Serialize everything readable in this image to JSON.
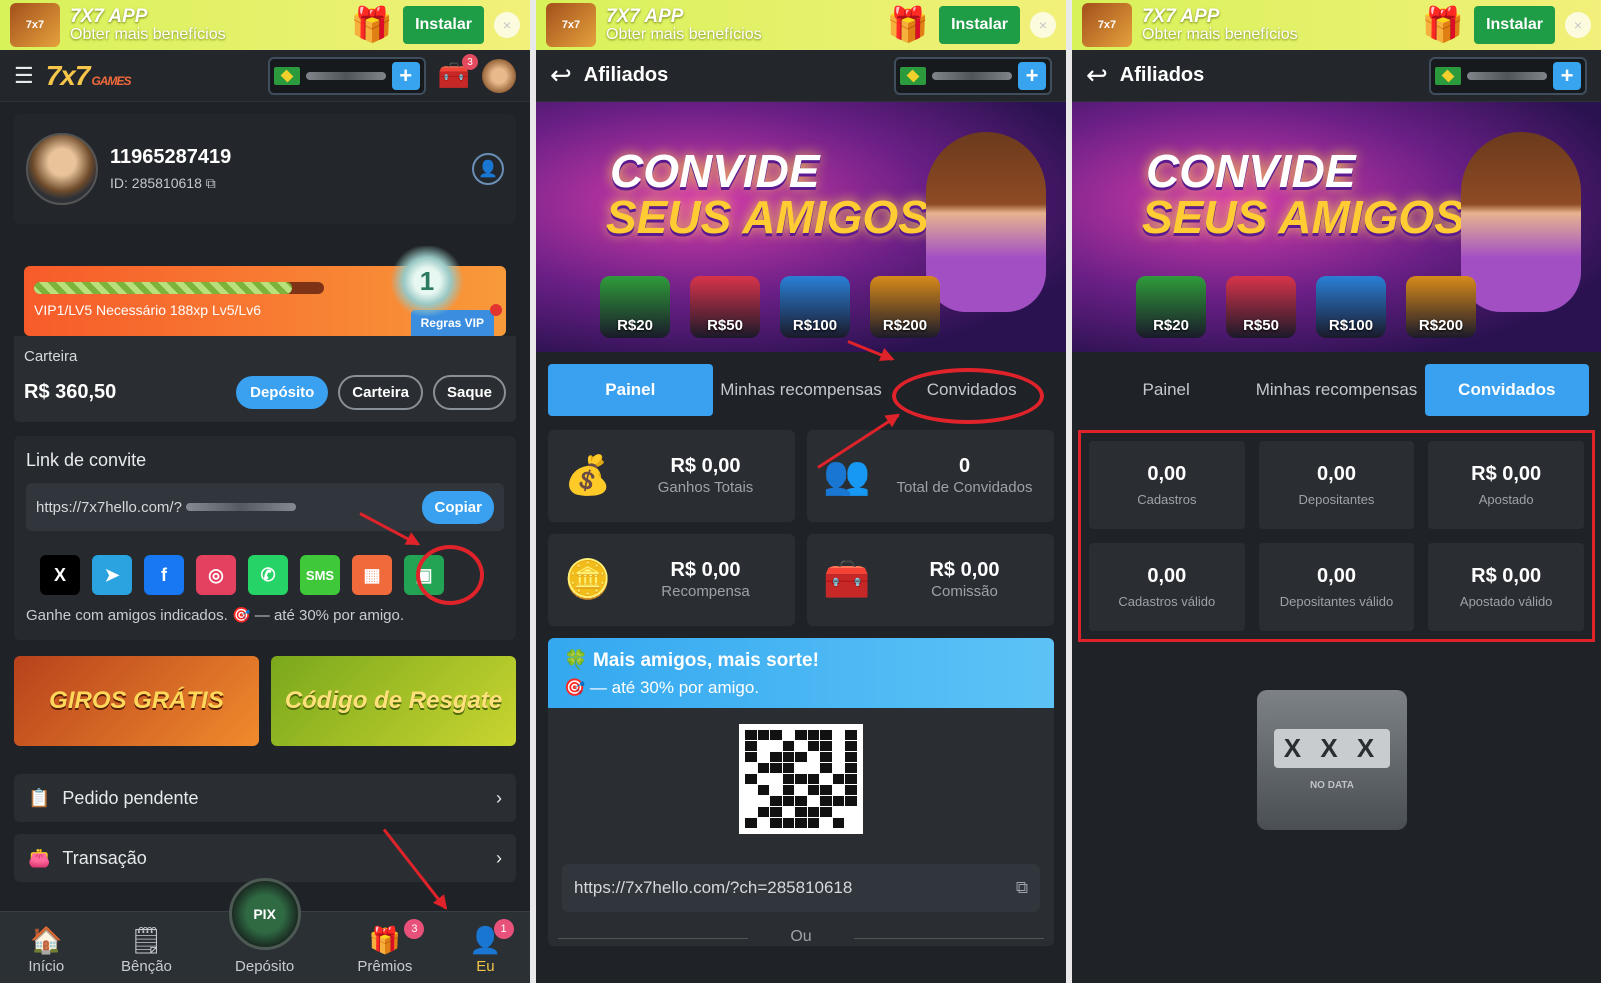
{
  "banner": {
    "app_name": "7X7 APP",
    "tagline": "Obter mais benefícios",
    "install_label": "Instalar",
    "close_glyph": "×"
  },
  "panel1": {
    "brand": "7x7",
    "brand_suffix": "GAMES",
    "chest_badge": "3",
    "user": {
      "name": "11965287419",
      "id": "ID: 285810618"
    },
    "vip": {
      "level_text": "VIP1/LV5   Necessário 188xp Lv5/Lv6",
      "rules_label": "Regras VIP",
      "progress_percent": 89
    },
    "wallet": {
      "label": "Carteira",
      "amount": "R$ 360,50",
      "deposit": "Depósito",
      "wallet": "Carteira",
      "withdraw": "Saque"
    },
    "invite": {
      "title": "Link de convite",
      "url": "https://7x7hello.com/?",
      "copy": "Copiar",
      "socials": [
        {
          "label": "X",
          "name": "x-icon",
          "color": "#000000"
        },
        {
          "label": "➤",
          "name": "telegram-icon",
          "color": "#2aa3e0"
        },
        {
          "label": "f",
          "name": "facebook-icon",
          "color": "#1877f2"
        },
        {
          "label": "◎",
          "name": "instagram-icon",
          "color": "#e4405f"
        },
        {
          "label": "✆",
          "name": "whatsapp-icon",
          "color": "#25d366"
        },
        {
          "label": "SMS",
          "name": "sms-icon",
          "color": "#3fc83a"
        },
        {
          "label": "▦",
          "name": "apps-icon",
          "color": "#f06a3b"
        },
        {
          "label": "▣",
          "name": "more-apps-icon",
          "color": "#23a455"
        }
      ],
      "earn_text": "Ganhe com amigos indicados. 🎯 — até 30% por amigo."
    },
    "promos": {
      "giros": "GIROS GRÁTIS",
      "codigo": "Código de Resgate"
    },
    "menu": {
      "pending": "Pedido pendente",
      "transaction": "Transação"
    },
    "nav": {
      "home": "Início",
      "blessing": "Bênção",
      "deposit": "Depósito",
      "pix": "PIX",
      "prizes": "Prêmios",
      "prizes_badge": "3",
      "me": "Eu",
      "me_badge": "1"
    }
  },
  "panel2": {
    "title": "Afiliados",
    "hero": {
      "line1": "CONVIDE",
      "line2": "SEUS AMIGOS!",
      "prizes": [
        "R$20",
        "R$50",
        "R$100",
        "R$200"
      ]
    },
    "tabs": [
      "Painel",
      "Minhas recompensas",
      "Convidados"
    ],
    "stats": [
      {
        "value": "R$ 0,00",
        "label": "Ganhos Totais",
        "icon": "treasure-chest-icon",
        "glyph": "💰"
      },
      {
        "value": "0",
        "label": "Total de Convidados",
        "icon": "people-icon",
        "glyph": "👥"
      },
      {
        "value": "R$ 0,00",
        "label": "Recompensa",
        "icon": "coin-stack-icon",
        "glyph": "🪙"
      },
      {
        "value": "R$ 0,00",
        "label": "Comissão",
        "icon": "cash-chest-icon",
        "glyph": "🧰"
      }
    ],
    "more": {
      "title": "Mais amigos, mais sorte!",
      "sub": "— até 30% por amigo."
    },
    "link": "https://7x7hello.com/?ch=285810618",
    "or": "Ou"
  },
  "panel3": {
    "title": "Afiliados",
    "tabs": [
      "Painel",
      "Minhas recompensas",
      "Convidados"
    ],
    "cells": [
      {
        "value": "0,00",
        "label": "Cadastros"
      },
      {
        "value": "0,00",
        "label": "Depositantes"
      },
      {
        "value": "R$ 0,00",
        "label": "Apostado"
      },
      {
        "value": "0,00",
        "label": "Cadastros válido"
      },
      {
        "value": "0,00",
        "label": "Depositantes válido"
      },
      {
        "value": "R$ 0,00",
        "label": "Apostado válido"
      }
    ],
    "nodata_symbols": "X X X",
    "nodata_label": "NO DATA"
  },
  "colors": {
    "accent": "#3aa0f0",
    "annotation": "#e0232a",
    "background": "#1f2226"
  }
}
